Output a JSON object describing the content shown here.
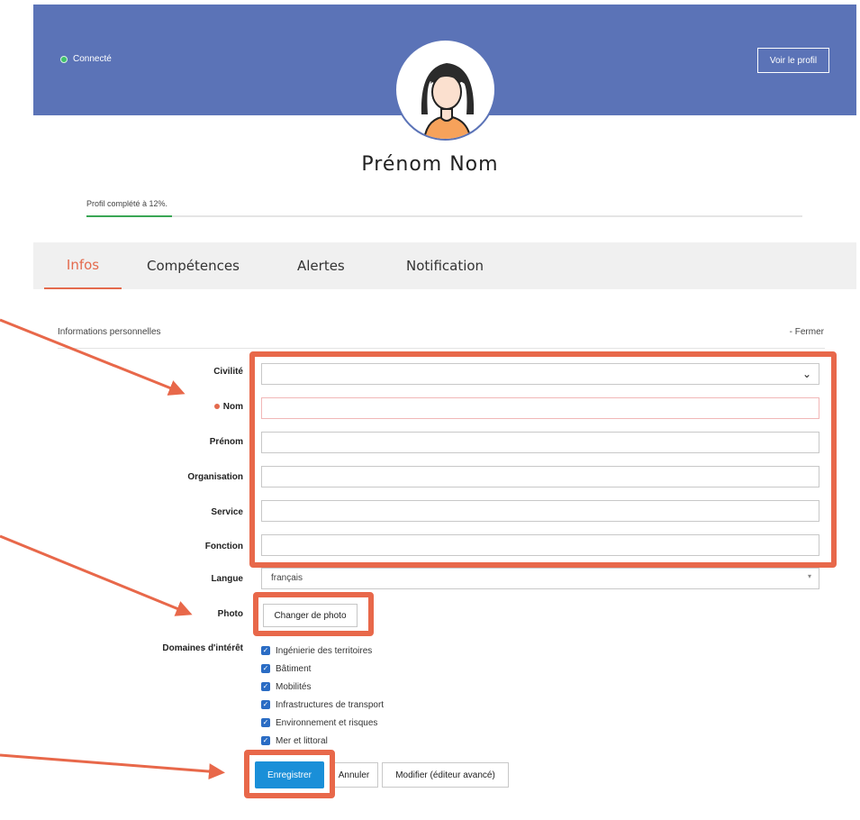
{
  "header": {
    "status": "Connecté",
    "view_profile": "Voir le profil"
  },
  "profile": {
    "full_name": "Prénom Nom",
    "completion_label": "Profil complété à 12%.",
    "completion_percent": 12
  },
  "tabs": [
    {
      "label": "Infos",
      "active": true
    },
    {
      "label": "Compétences",
      "active": false
    },
    {
      "label": "Alertes",
      "active": false
    },
    {
      "label": "Notification",
      "active": false
    }
  ],
  "section": {
    "title": "Informations personnelles",
    "close": "- Fermer"
  },
  "form": {
    "civilite": {
      "label": "Civilité",
      "value": ""
    },
    "nom": {
      "label": "Nom",
      "value": "",
      "required": true
    },
    "prenom": {
      "label": "Prénom",
      "value": ""
    },
    "organisation": {
      "label": "Organisation",
      "value": ""
    },
    "service": {
      "label": "Service",
      "value": ""
    },
    "fonction": {
      "label": "Fonction",
      "value": ""
    },
    "langue": {
      "label": "Langue",
      "value": "français"
    },
    "photo": {
      "label": "Photo",
      "button": "Changer de photo"
    },
    "interests": {
      "label": "Domaines d'intérêt",
      "items": [
        {
          "label": "Ingénierie des territoires",
          "checked": true
        },
        {
          "label": "Bâtiment",
          "checked": true
        },
        {
          "label": "Mobilités",
          "checked": true
        },
        {
          "label": "Infrastructures de transport",
          "checked": true
        },
        {
          "label": "Environnement et risques",
          "checked": true
        },
        {
          "label": "Mer et littoral",
          "checked": true
        }
      ]
    }
  },
  "actions": {
    "save": "Enregistrer",
    "cancel": "Annuler",
    "advanced": "Modifier (éditeur avancé)"
  },
  "colors": {
    "banner": "#5b73b7",
    "accent": "#e46a4d",
    "annotation": "#e8684a",
    "primary_button": "#1a8fd8"
  }
}
